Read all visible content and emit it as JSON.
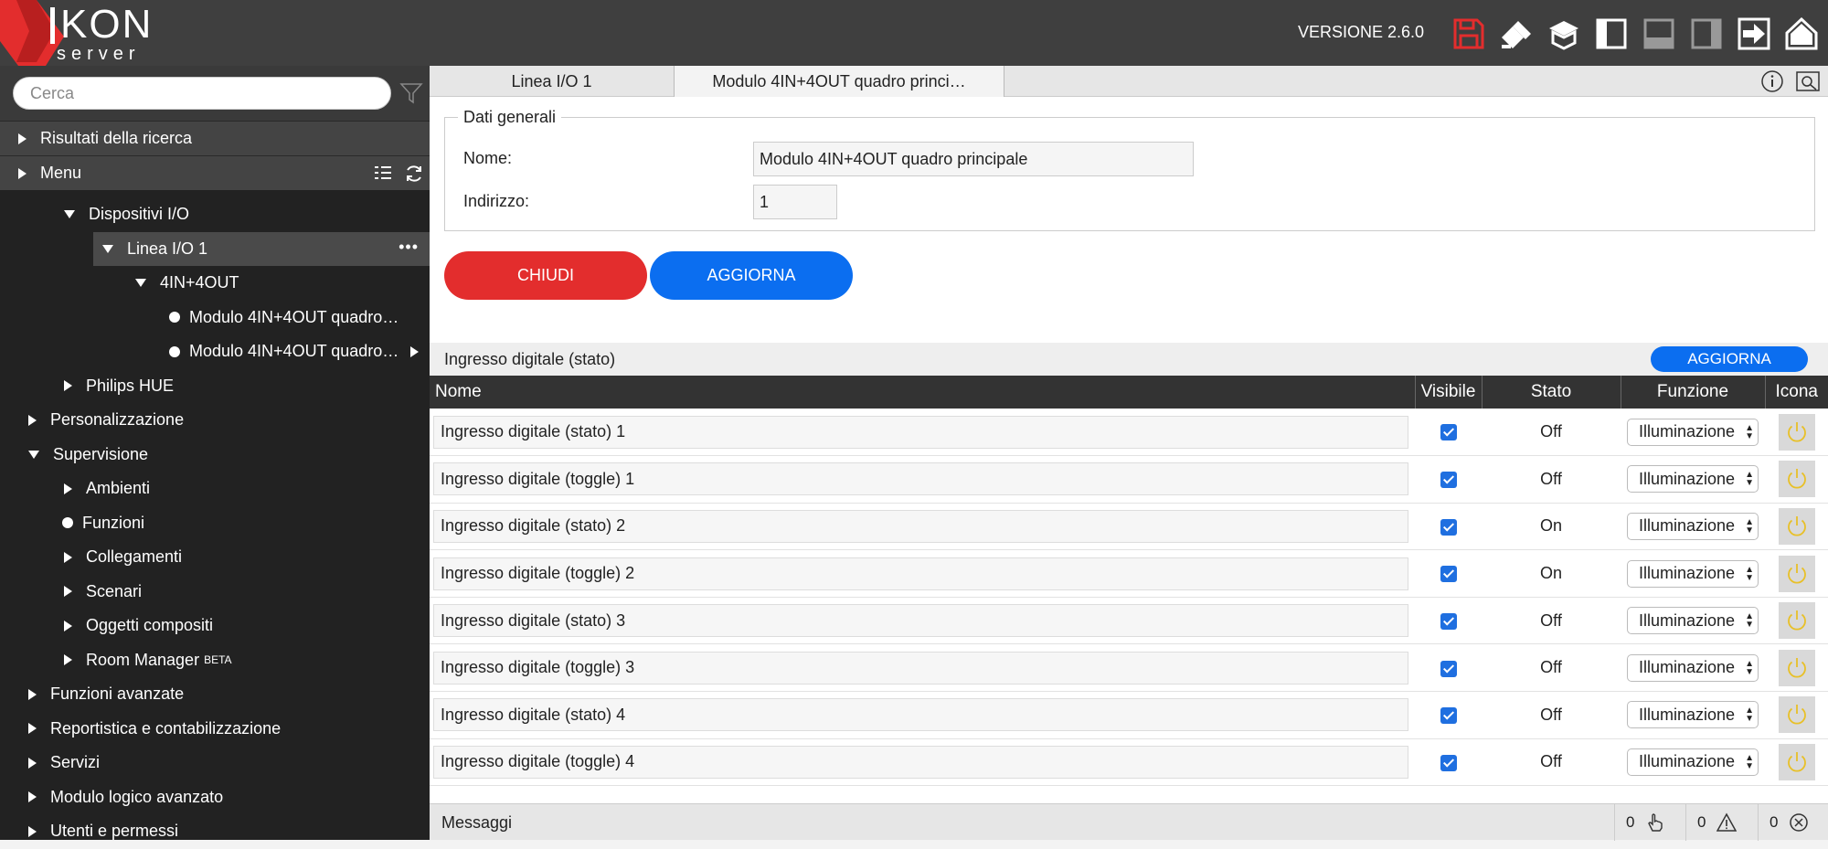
{
  "header": {
    "logo_text": "KON",
    "logo_sub": "server",
    "version": "VERSIONE 2.6.0",
    "icons": [
      "save-icon",
      "brush-icon",
      "graduation-cap-icon",
      "layout-left-icon",
      "layout-bottom-icon",
      "layout-right-icon",
      "logout-icon",
      "home-icon"
    ],
    "accent_red": "#e32d2d"
  },
  "sidebar": {
    "search_placeholder": "Cerca",
    "sections": [
      {
        "label": "Risultati della ricerca"
      },
      {
        "label": "Menu"
      }
    ],
    "tree": [
      {
        "label": "Dispositivi I/O",
        "level": 2,
        "marker": "down"
      },
      {
        "label": "Linea I/O 1",
        "level": 3,
        "marker": "down",
        "selected": true
      },
      {
        "label": "4IN+4OUT",
        "level": 4,
        "marker": "down"
      },
      {
        "label": "Modulo 4IN+4OUT quadro…",
        "level": 5,
        "marker": "dot"
      },
      {
        "label": "Modulo 4IN+4OUT quadro…",
        "level": 5,
        "marker": "dot"
      },
      {
        "label": "Philips HUE",
        "level": 2,
        "marker": "right"
      },
      {
        "label": "Personalizzazione",
        "level": 1,
        "marker": "right"
      },
      {
        "label": "Supervisione",
        "level": 1,
        "marker": "down"
      },
      {
        "label": "Ambienti",
        "level": 2,
        "marker": "right"
      },
      {
        "label": "Funzioni",
        "level": 2,
        "marker": "dot"
      },
      {
        "label": "Collegamenti",
        "level": 2,
        "marker": "right"
      },
      {
        "label": "Scenari",
        "level": 2,
        "marker": "right"
      },
      {
        "label": "Oggetti compositi",
        "level": 2,
        "marker": "right"
      },
      {
        "label": "Room Manager",
        "sup": "BETA",
        "level": 2,
        "marker": "right"
      },
      {
        "label": "Funzioni avanzate",
        "level": 1,
        "marker": "right"
      },
      {
        "label": "Reportistica e contabilizzazione",
        "level": 1,
        "marker": "right"
      },
      {
        "label": "Servizi",
        "level": 1,
        "marker": "right"
      },
      {
        "label": "Modulo logico avanzato",
        "level": 1,
        "marker": "right"
      },
      {
        "label": "Utenti e permessi",
        "level": 1,
        "marker": "right"
      }
    ]
  },
  "tabs": [
    {
      "label": "Linea I/O 1"
    },
    {
      "label": "Modulo 4IN+4OUT quadro princi…"
    }
  ],
  "general": {
    "legend": "Dati generali",
    "name_label": "Nome:",
    "name_value": "Modulo 4IN+4OUT quadro principale",
    "address_label": "Indirizzo:",
    "address_value": "1"
  },
  "buttons": {
    "close": "CHIUDI",
    "update": "AGGIORNA"
  },
  "inputs_section": {
    "title": "Ingresso digitale (stato)",
    "update": "AGGIORNA",
    "columns": [
      "Nome",
      "Visibile",
      "Stato",
      "Funzione",
      "Icona"
    ],
    "rows": [
      {
        "name": "Ingresso digitale (stato) 1",
        "visible": true,
        "state": "Off",
        "function": "Illuminazione"
      },
      {
        "name": "Ingresso digitale (toggle) 1",
        "visible": true,
        "state": "Off",
        "function": "Illuminazione"
      },
      {
        "name": "Ingresso digitale (stato) 2",
        "visible": true,
        "state": "On",
        "function": "Illuminazione"
      },
      {
        "name": "Ingresso digitale (toggle) 2",
        "visible": true,
        "state": "On",
        "function": "Illuminazione"
      },
      {
        "name": "Ingresso digitale (stato) 3",
        "visible": true,
        "state": "Off",
        "function": "Illuminazione"
      },
      {
        "name": "Ingresso digitale (toggle) 3",
        "visible": true,
        "state": "Off",
        "function": "Illuminazione"
      },
      {
        "name": "Ingresso digitale (stato) 4",
        "visible": true,
        "state": "Off",
        "function": "Illuminazione"
      },
      {
        "name": "Ingresso digitale (toggle) 4",
        "visible": true,
        "state": "Off",
        "function": "Illuminazione"
      }
    ]
  },
  "messages": {
    "title": "Messaggi",
    "counters": [
      {
        "count": "0",
        "icon": "hand-pointer-icon"
      },
      {
        "count": "0",
        "icon": "warning-icon"
      },
      {
        "count": "0",
        "icon": "error-circle-icon"
      }
    ]
  }
}
